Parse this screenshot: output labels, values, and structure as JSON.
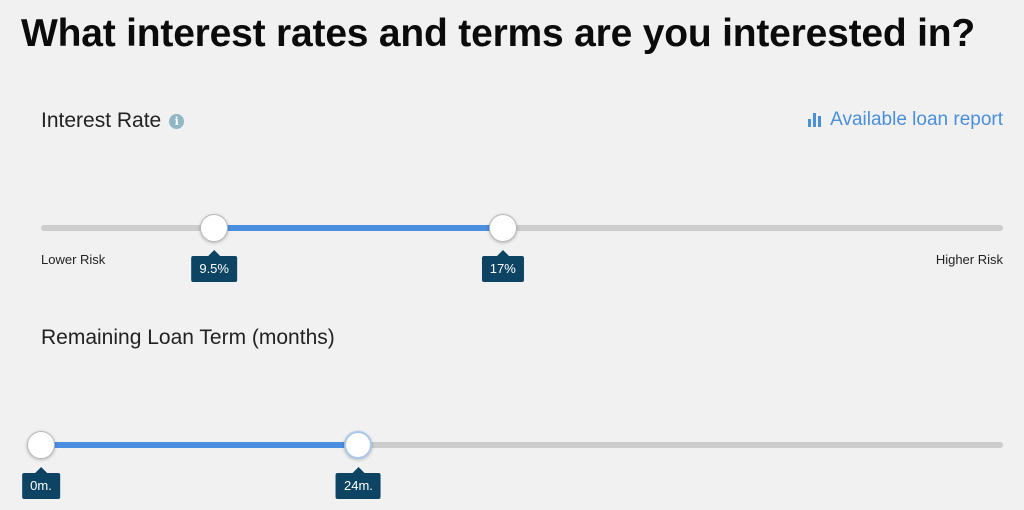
{
  "page": {
    "title": "What interest rates and terms are you interested in?"
  },
  "interest_rate": {
    "label": "Interest Rate",
    "info_icon": "info-icon",
    "report_link_label": "Available loan report",
    "report_link_icon": "bar-chart-icon",
    "low_end_label": "Lower Risk",
    "high_end_label": "Higher Risk",
    "min_value_label": "9.5%",
    "max_value_label": "17%",
    "selected_min_fraction": 0.18,
    "selected_max_fraction": 0.48
  },
  "loan_term": {
    "label": "Remaining Loan Term (months)",
    "min_value_label": "0m.",
    "max_value_label": "24m.",
    "selected_min_fraction": 0.0,
    "selected_max_fraction": 0.33
  },
  "colors": {
    "accent": "#4a8fe0",
    "link": "#4a8fd9",
    "bubble": "#0e4463",
    "track": "#cdcdcd",
    "background": "#f1f1f1"
  }
}
